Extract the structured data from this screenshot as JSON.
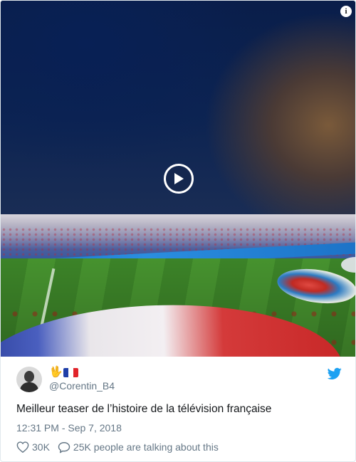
{
  "media": {
    "play_icon": "play-icon",
    "info_icon": "info-icon",
    "info_symbol": "i"
  },
  "author": {
    "display_name_emoji": "🖖",
    "flag": "french-flag",
    "flag_colors": [
      "#1f3fa8",
      "#ffffff",
      "#e1242b"
    ],
    "handle": "@Corentin_B4",
    "avatar": "avatar"
  },
  "brand": {
    "icon": "twitter-bird-icon",
    "color": "#1da1f2"
  },
  "tweet": {
    "text": "Meilleur teaser de l’histoire de la télévision française",
    "timestamp": "12:31 PM - Sep 7, 2018"
  },
  "actions": {
    "likes": "30K",
    "talking": "25K people are talking about this",
    "like_icon": "heart-icon",
    "reply_icon": "speech-bubble-icon"
  }
}
